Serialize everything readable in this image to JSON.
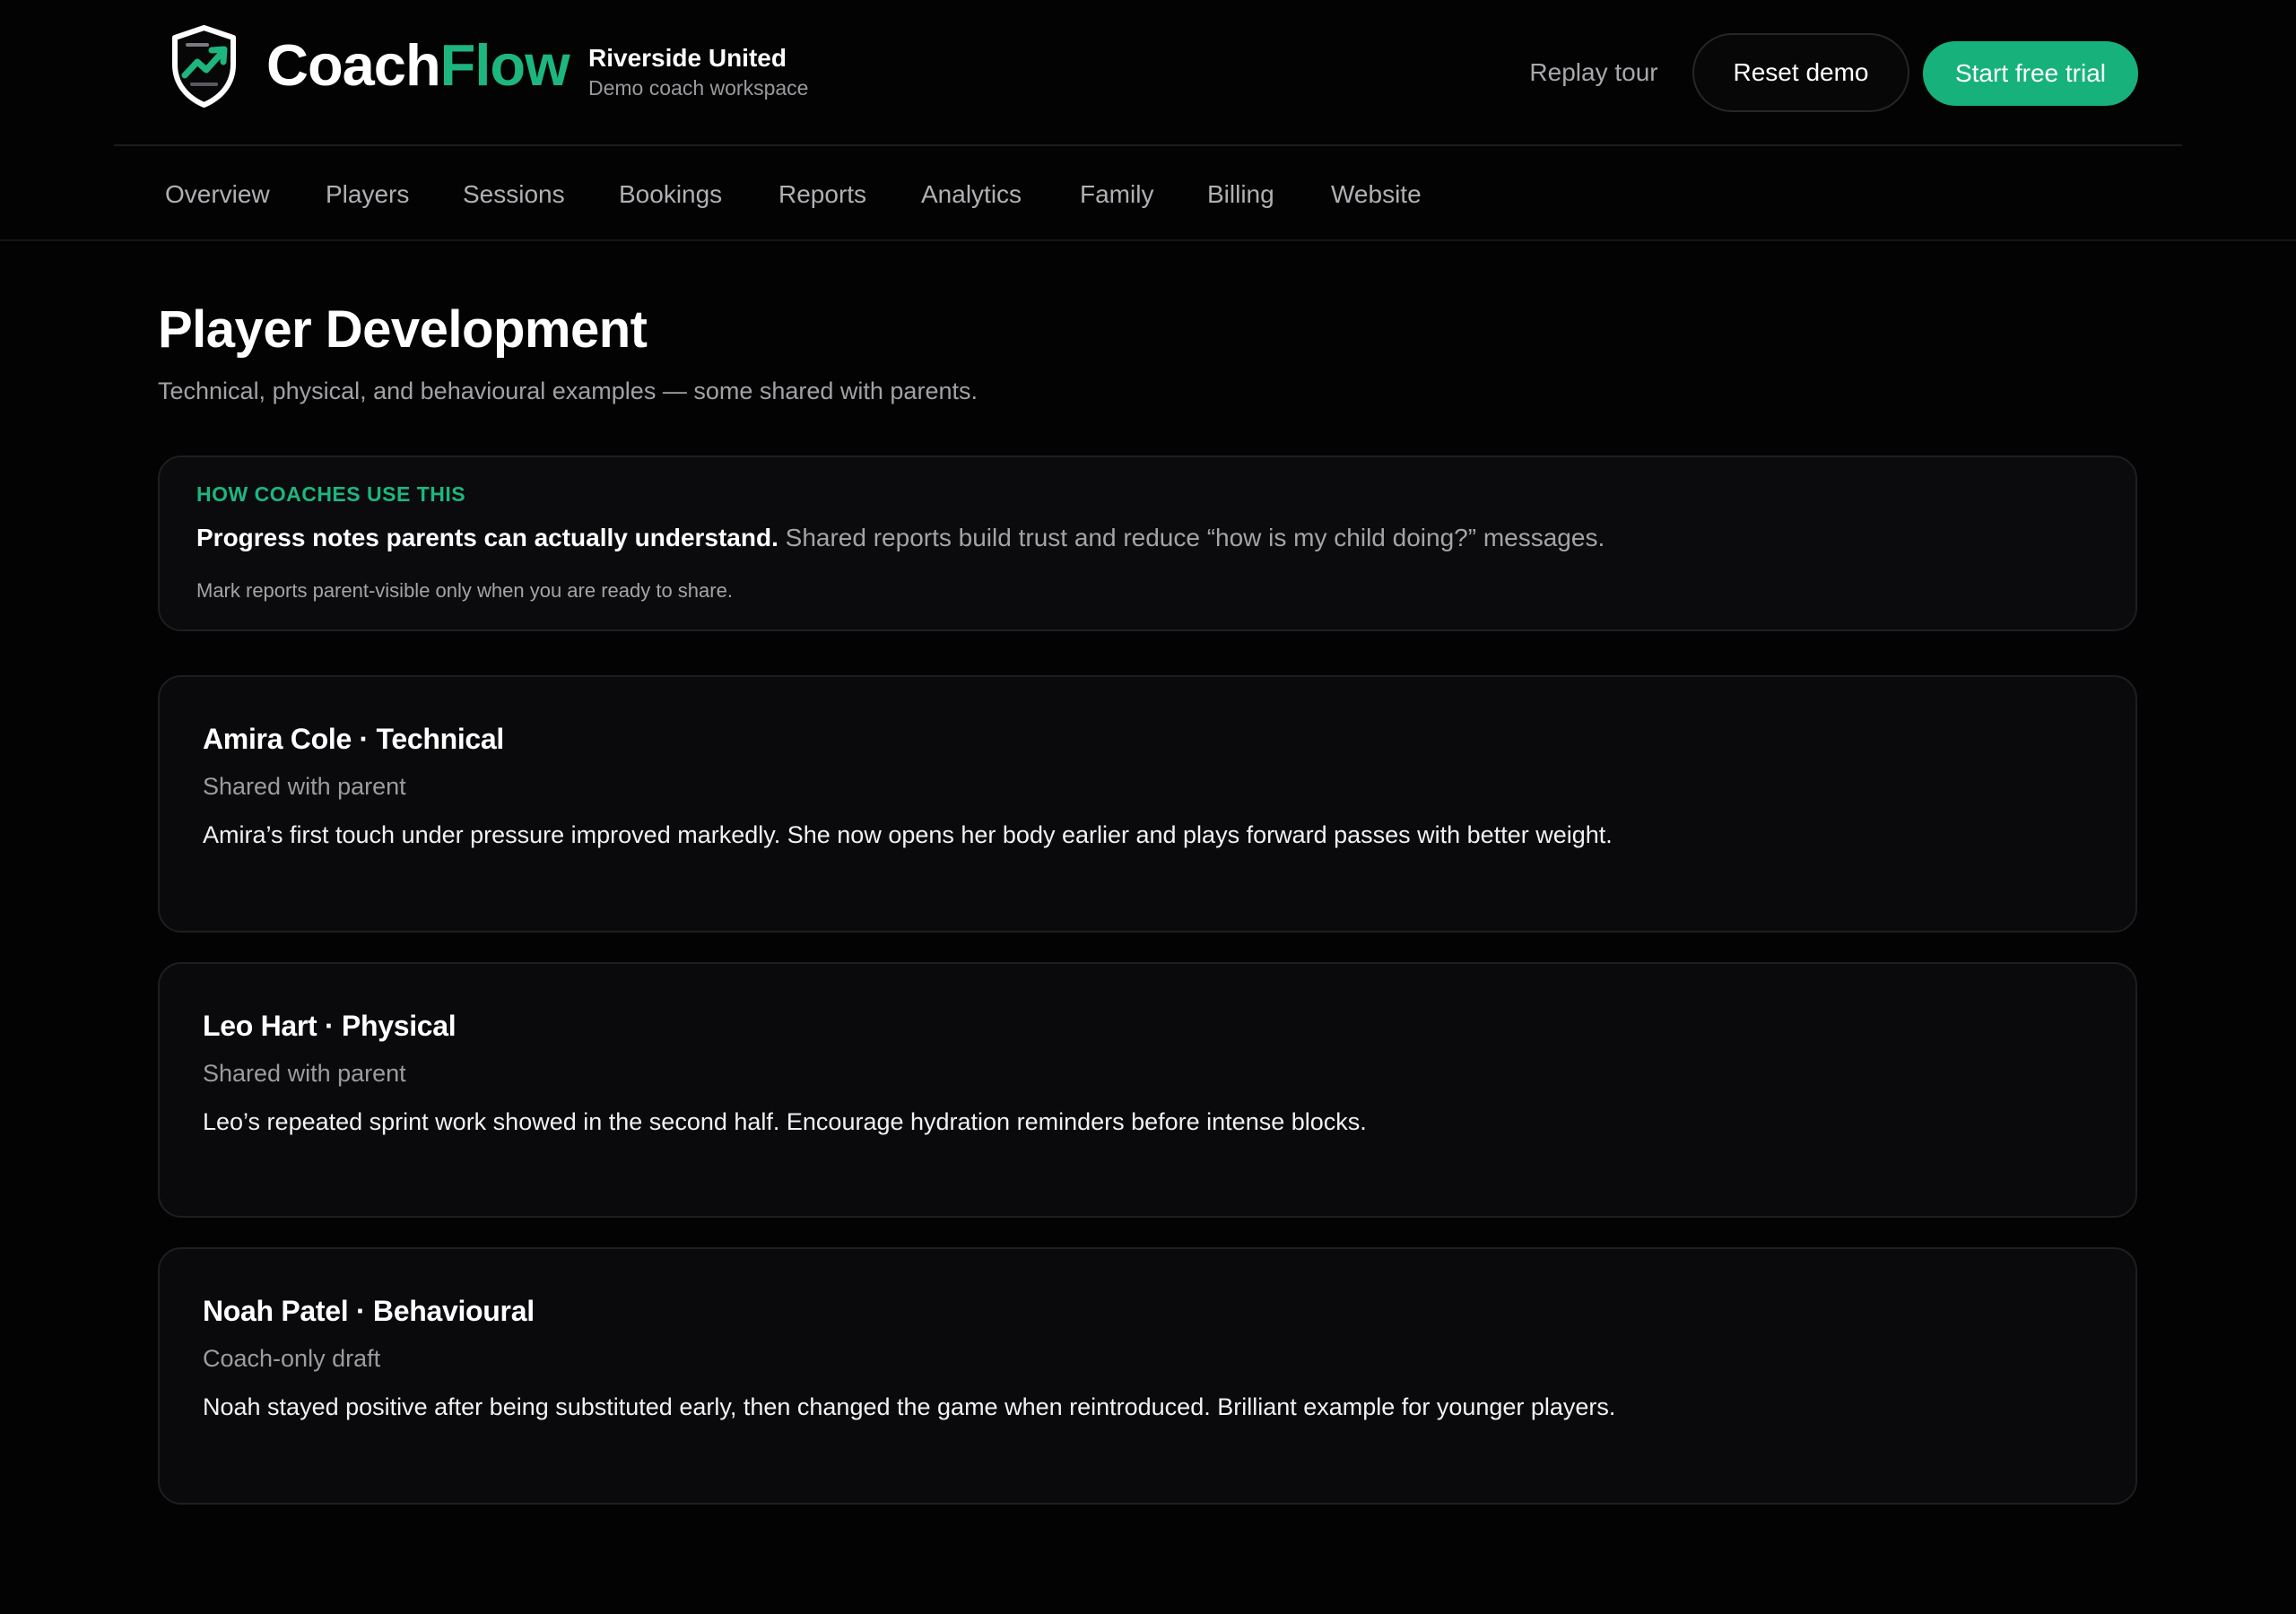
{
  "header": {
    "brand_part1": "Coach",
    "brand_part2": "Flow",
    "club_name": "Riverside United",
    "workspace_label": "Demo coach workspace",
    "replay_tour": "Replay tour",
    "reset_demo": "Reset demo",
    "start_trial": "Start free trial",
    "logo_icon": "shield-trend-icon"
  },
  "nav": {
    "items": [
      "Overview",
      "Players",
      "Sessions",
      "Bookings",
      "Reports",
      "Analytics",
      "Family",
      "Billing",
      "Website"
    ]
  },
  "page": {
    "title": "Player Development",
    "subtitle": "Technical, physical, and behavioural examples — some shared with parents."
  },
  "info": {
    "eyebrow": "HOW COACHES USE THIS",
    "headline": "Progress notes parents can actually understand.",
    "headline_rest": "Shared reports build trust and reduce “how is my child doing?” messages.",
    "note": "Mark reports parent-visible only when you are ready to share."
  },
  "reports": [
    {
      "title": "Amira Cole · Technical",
      "status": "Shared with parent",
      "body": "Amira’s first touch under pressure improved markedly. She now opens her body earlier and plays forward passes with better weight."
    },
    {
      "title": "Leo Hart · Physical",
      "status": "Shared with parent",
      "body": "Leo’s repeated sprint work showed in the second half. Encourage hydration reminders before intense blocks."
    },
    {
      "title": "Noah Patel · Behavioural",
      "status": "Coach-only draft",
      "body": "Noah stayed positive after being substituted early, then changed the game when reintroduced. Brilliant example for younger players."
    }
  ],
  "colors": {
    "background": "#030303",
    "accent": "#17b27c",
    "card": "#0a0a0c"
  }
}
